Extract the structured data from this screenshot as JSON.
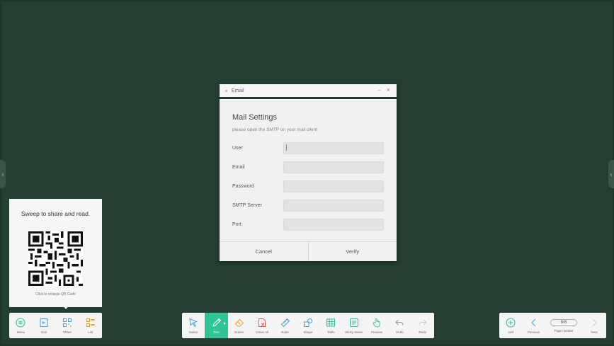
{
  "dialog": {
    "title": "Email",
    "minimize_glyph": "–",
    "close_glyph": "×",
    "heading": "Mail Settings",
    "subtitle": "please open the SMTP on your mail client",
    "fields": [
      {
        "label": "User",
        "value": ""
      },
      {
        "label": "Email",
        "value": ""
      },
      {
        "label": "Password",
        "value": ""
      },
      {
        "label": "SMTP Server",
        "value": ""
      },
      {
        "label": "Port",
        "value": ""
      }
    ],
    "cancel_label": "Cancel",
    "verify_label": "Verify"
  },
  "share_panel": {
    "title": "Sweep to share and read.",
    "hint": "Click to enlarge QR Code"
  },
  "left_toolbar": {
    "items": [
      {
        "label": "Menu",
        "icon": "menu-icon"
      },
      {
        "label": "Exit",
        "icon": "exit-icon"
      },
      {
        "label": "Share",
        "icon": "qr-icon"
      },
      {
        "label": "List",
        "icon": "list-icon"
      }
    ]
  },
  "center_toolbar": {
    "items": [
      {
        "label": "Select",
        "icon": "cursor-icon"
      },
      {
        "label": "Pen",
        "icon": "pen-icon",
        "active": true
      },
      {
        "label": "Eraser",
        "icon": "eraser-icon"
      },
      {
        "label": "Clean All",
        "icon": "clean-all-icon"
      },
      {
        "label": "Ruler",
        "icon": "ruler-icon"
      },
      {
        "label": "Shape",
        "icon": "shape-icon"
      },
      {
        "label": "Table",
        "icon": "table-icon"
      },
      {
        "label": "Sticky-Notes",
        "icon": "sticky-note-icon"
      },
      {
        "label": "Preview",
        "icon": "preview-hand-icon"
      },
      {
        "label": "Undo",
        "icon": "undo-icon"
      },
      {
        "label": "Redo",
        "icon": "redo-icon"
      }
    ]
  },
  "right_toolbar": {
    "add_label": "Add",
    "previous_label": "Previous",
    "page_indicator": "8/8",
    "page_number_label": "Page number",
    "next_label": "Next"
  },
  "colors": {
    "background": "#243e31",
    "accent": "#2ec495",
    "icon_blue": "#4a9fd8",
    "icon_orange": "#f0a030",
    "icon_red": "#e35d5d",
    "icon_green": "#2ec495"
  }
}
